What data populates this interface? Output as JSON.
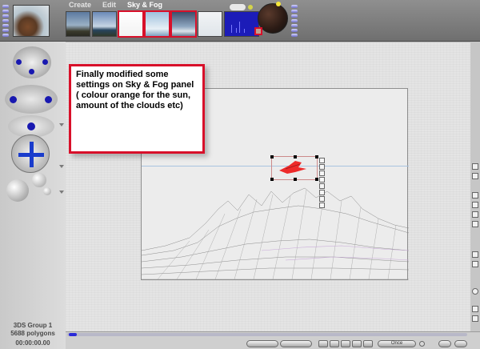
{
  "menu": {
    "create_label": "Create",
    "edit_label": "Edit",
    "section_label": "Sky & Fog"
  },
  "annotation": {
    "text": "Finally modified some settings on Sky & Fog panel ( colour orange for the sun, amount of the clouds etc)"
  },
  "status": {
    "object_name": "3DS Group 1",
    "polygons": "5688 polygons",
    "timecode": "00:00:00.00"
  },
  "timeline": {
    "mode_label": "Once"
  },
  "colors": {
    "highlight": "#d8102a",
    "sun_object": "#ee2a2a",
    "accent_blue": "#1a3ccc"
  },
  "icons": {
    "camera": "camera-trackball-icon",
    "move": "move-cross-icon",
    "sun": "sun-light-icon"
  }
}
